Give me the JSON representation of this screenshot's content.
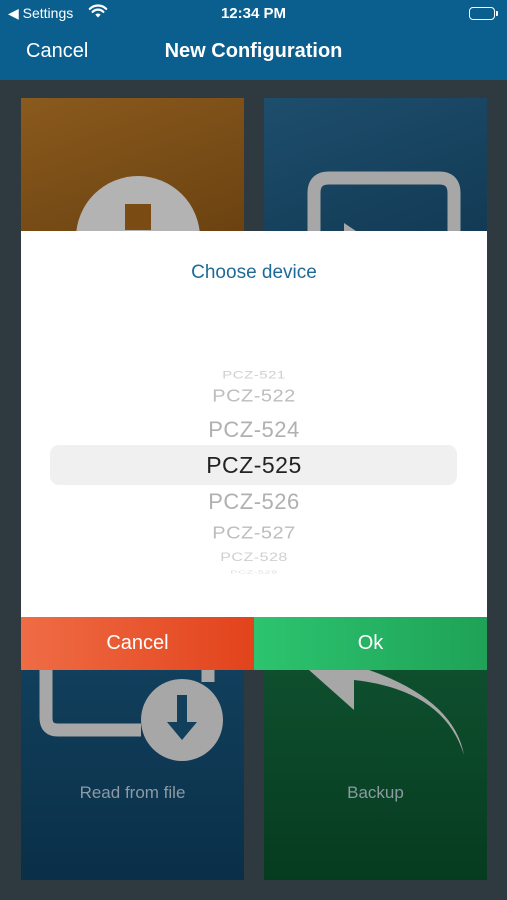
{
  "status_bar": {
    "back_label": "◀ Settings",
    "time": "12:34 PM",
    "wifi_icon": "wifi-icon",
    "battery_icon": "battery-icon"
  },
  "nav": {
    "cancel_label": "Cancel",
    "title": "New Configuration"
  },
  "tiles": {
    "read_from_file": "Read from file",
    "backup": "Backup"
  },
  "dialog": {
    "title": "Choose device",
    "picker_items": [
      "PCZ-521",
      "PCZ-522",
      "PCZ-524",
      "PCZ-525",
      "PCZ-526",
      "PCZ-527",
      "PCZ-528",
      "PCZ-529"
    ],
    "selected": "PCZ-525",
    "cancel_label": "Cancel",
    "ok_label": "Ok"
  },
  "colors": {
    "nav_bar": "#0b5f8f",
    "dialog_title": "#1e6a99",
    "cancel_button": "#e9542f",
    "ok_button": "#26b563"
  }
}
